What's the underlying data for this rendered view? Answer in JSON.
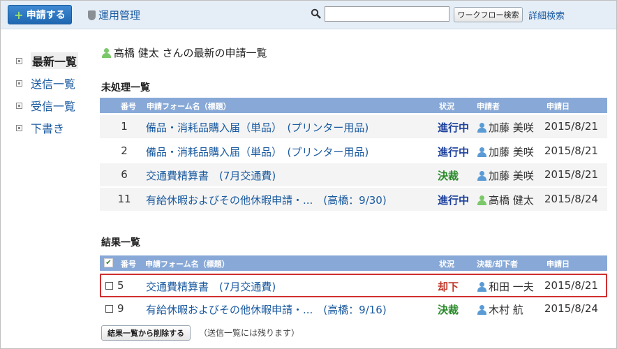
{
  "header": {
    "apply_button": "申請する",
    "admin_link": "運用管理",
    "search_value": "",
    "workflow_search_button": "ワークフロー検索",
    "advanced_search": "詳細検索"
  },
  "sidebar": {
    "items": [
      {
        "label": "最新一覧",
        "current": true
      },
      {
        "label": "送信一覧"
      },
      {
        "label": "受信一覧"
      },
      {
        "label": "下書き"
      }
    ]
  },
  "page_title": "高橋 健太 さんの最新の申請一覧",
  "pending": {
    "title": "未処理一覧",
    "headers": {
      "num": "番号",
      "form": "申請フォーム名（標題）",
      "status": "状況",
      "applicant": "申請者",
      "date": "申請日"
    },
    "rows": [
      {
        "num": "1",
        "form": "備品・消耗品購入届（単品）　(プリンター用品)",
        "status": "進行中",
        "person": "加藤 美咲",
        "date": "2015/8/21"
      },
      {
        "num": "2",
        "form": "備品・消耗品購入届（単品）　(プリンター用品)",
        "status": "進行中",
        "person": "加藤 美咲",
        "date": "2015/8/21"
      },
      {
        "num": "6",
        "form": "交通費精算書　(7月交通費)",
        "status": "決裁",
        "person": "加藤 美咲",
        "date": "2015/8/21"
      },
      {
        "num": "11",
        "form": "有給休暇およびその他休暇申請・...　(高橋：9/30)",
        "status": "進行中",
        "person": "高橋 健太",
        "date": "2015/8/24"
      }
    ]
  },
  "results": {
    "title": "結果一覧",
    "headers": {
      "num": "番号",
      "form": "申請フォーム名（標題）",
      "status": "状況",
      "decider": "決裁/却下者",
      "date": "申請日"
    },
    "rows": [
      {
        "num": "5",
        "form": "交通費精算書　(7月交通費)",
        "status": "却下",
        "person": "和田 一夫",
        "date": "2015/8/21"
      },
      {
        "num": "9",
        "form": "有給休暇およびその他休暇申請・...　(高橋：9/16)",
        "status": "決裁",
        "person": "木村 航",
        "date": "2015/8/24"
      }
    ],
    "delete_button": "結果一覧から削除する",
    "delete_note": "（送信一覧には残ります）"
  },
  "colors": {
    "header_bar": "#88a9d7",
    "status_in_progress": "#1b3f9c",
    "status_approved": "#2a8a2a",
    "status_rejected": "#c0392b",
    "selection_border": "#d03030"
  }
}
